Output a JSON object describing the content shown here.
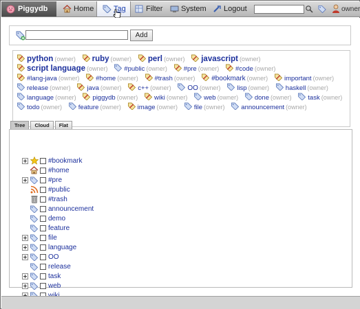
{
  "header": {
    "app_title": "Piggydb",
    "nav": [
      {
        "label": "Home",
        "icon": "home-icon"
      },
      {
        "label": "Tag",
        "icon": "tag-icon"
      },
      {
        "label": "Filter",
        "icon": "filter-icon"
      },
      {
        "label": "System",
        "icon": "system-icon"
      },
      {
        "label": "Logout",
        "icon": "logout-icon"
      }
    ],
    "search_value": "",
    "user": "owner"
  },
  "add_tag": {
    "input_value": "",
    "button_label": "Add"
  },
  "tag_cloud": [
    {
      "name": "python",
      "owner": "(owner)",
      "size": 3
    },
    {
      "name": "ruby",
      "owner": "(owner)",
      "size": 3
    },
    {
      "name": "perl",
      "owner": "(owner)",
      "size": 3
    },
    {
      "name": "javascript",
      "owner": "(owner)",
      "size": 3
    },
    {
      "name": "script language",
      "owner": "(owner)",
      "size": 3
    },
    {
      "name": "#public",
      "owner": "(owner)",
      "size": 1
    },
    {
      "name": "#pre",
      "owner": "(owner)",
      "size": 1
    },
    {
      "name": "#code",
      "owner": "(owner)",
      "size": 1
    },
    {
      "name": "#lang-java",
      "owner": "(owner)",
      "size": 1
    },
    {
      "name": "#home",
      "owner": "(owner)",
      "size": 1
    },
    {
      "name": "#trash",
      "owner": "(owner)",
      "size": 1
    },
    {
      "name": "#bookmark",
      "owner": "(owner)",
      "size": 2
    },
    {
      "name": "important",
      "owner": "(owner)",
      "size": 1
    },
    {
      "name": "release",
      "owner": "(owner)",
      "size": 1
    },
    {
      "name": "java",
      "owner": "(owner)",
      "size": 1
    },
    {
      "name": "c++",
      "owner": "(owner)",
      "size": 1
    },
    {
      "name": "OO",
      "owner": "(owner)",
      "size": 2
    },
    {
      "name": "lisp",
      "owner": "(owner)",
      "size": 1
    },
    {
      "name": "haskell",
      "owner": "(owner)",
      "size": 1
    },
    {
      "name": "language",
      "owner": "(owner)",
      "size": 1
    },
    {
      "name": "piggydb",
      "owner": "(owner)",
      "size": 1
    },
    {
      "name": "wiki",
      "owner": "(owner)",
      "size": 1
    },
    {
      "name": "web",
      "owner": "(owner)",
      "size": 1
    },
    {
      "name": "done",
      "owner": "(owner)",
      "size": 1
    },
    {
      "name": "task",
      "owner": "(owner)",
      "size": 1
    },
    {
      "name": "todo",
      "owner": "(owner)",
      "size": 1
    },
    {
      "name": "feature",
      "owner": "(owner)",
      "size": 1
    },
    {
      "name": "image",
      "owner": "(owner)",
      "size": 1
    },
    {
      "name": "file",
      "owner": "(owner)",
      "size": 1
    },
    {
      "name": "announcement",
      "owner": "(owner)",
      "size": 1
    }
  ],
  "view_tabs": [
    "Tree",
    "Cloud",
    "Flat"
  ],
  "tree": [
    {
      "name": "#bookmark",
      "icon": "star-icon",
      "expandable": true
    },
    {
      "name": "#home",
      "icon": "home-icon",
      "expandable": false
    },
    {
      "name": "#pre",
      "icon": "tag-icon",
      "expandable": true
    },
    {
      "name": "#public",
      "icon": "feed-icon",
      "expandable": false
    },
    {
      "name": "#trash",
      "icon": "trash-icon",
      "expandable": false
    },
    {
      "name": "announcement",
      "icon": "tag-icon",
      "expandable": false
    },
    {
      "name": "demo",
      "icon": "tag-icon",
      "expandable": false
    },
    {
      "name": "feature",
      "icon": "tag-icon",
      "expandable": false
    },
    {
      "name": "file",
      "icon": "tag-icon",
      "expandable": true
    },
    {
      "name": "language",
      "icon": "tag-icon",
      "expandable": true
    },
    {
      "name": "OO",
      "icon": "tag-icon",
      "expandable": true
    },
    {
      "name": "release",
      "icon": "tag-icon",
      "expandable": false
    },
    {
      "name": "task",
      "icon": "tag-icon",
      "expandable": true
    },
    {
      "name": "web",
      "icon": "tag-icon",
      "expandable": true
    },
    {
      "name": "wiki",
      "icon": "tag-icon",
      "expandable": true
    }
  ]
}
